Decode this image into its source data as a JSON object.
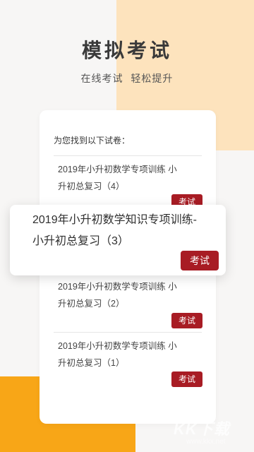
{
  "hero": {
    "title": "模拟考试",
    "subtitle": "在线考试  轻松提升"
  },
  "card": {
    "heading": "为您找到以下试卷：",
    "items": [
      {
        "title": "2019年小升初数学专项训练 小升初总复习（4）",
        "button": "考试"
      },
      {
        "title": "2019年小升初数学专项训练 小升初总复习（2）",
        "button": "考试"
      },
      {
        "title": "2019年小升初数学专项训练 小升初总复习（1）",
        "button": "考试"
      }
    ]
  },
  "popup": {
    "title": "2019年小升初数学知识专项训练-小升初总复习（3）",
    "button": "考试"
  },
  "watermark": {
    "logo": "KK下载",
    "url": "www.kkx.net"
  },
  "colors": {
    "accent_red": "#a81c24",
    "orange": "#f8a617",
    "peach": "#fde3bd"
  }
}
